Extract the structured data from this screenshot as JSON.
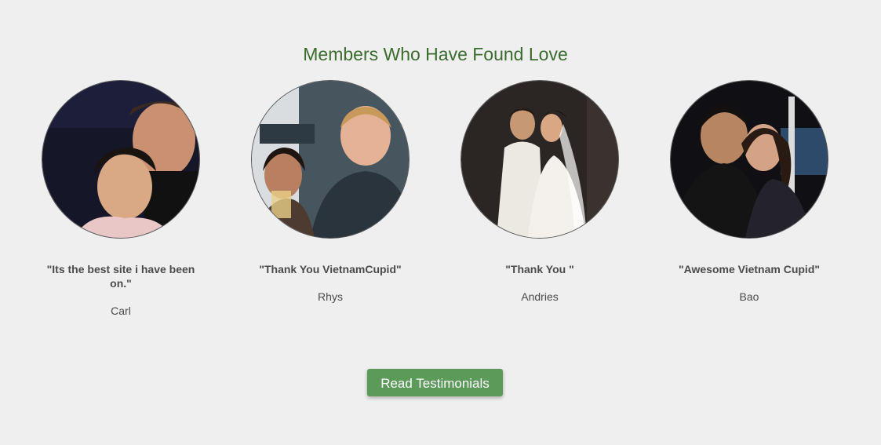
{
  "section": {
    "title": "Members Who Have Found Love"
  },
  "testimonials": [
    {
      "quote": "\"Its the best site i have been on.\"",
      "name": "Carl"
    },
    {
      "quote": "\"Thank You VietnamCupid\"",
      "name": "Rhys"
    },
    {
      "quote": "\"Thank You \"",
      "name": "Andries"
    },
    {
      "quote": "\"Awesome Vietnam Cupid\"",
      "name": "Bao"
    }
  ],
  "button": {
    "label": "Read Testimonials"
  },
  "colors": {
    "title": "#3b6b2f",
    "button": "#5c9a5a",
    "background": "#efefef"
  }
}
